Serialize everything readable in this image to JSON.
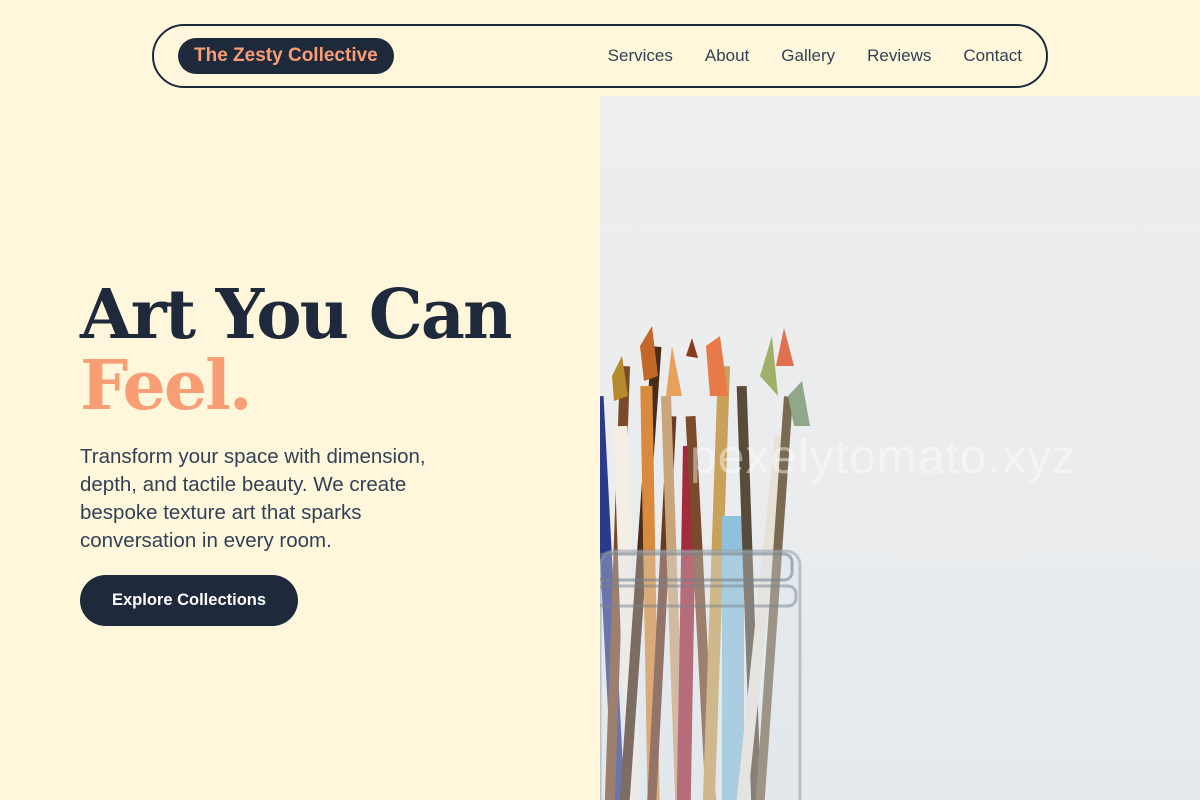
{
  "nav": {
    "brand": "The Zesty Collective",
    "links": [
      "Services",
      "About",
      "Gallery",
      "Reviews",
      "Contact"
    ]
  },
  "hero": {
    "headline_line1": "Art You Can",
    "headline_line2": "Feel.",
    "subtext": "Transform your space with dimension, depth, and tactile beauty. We create bespoke texture art that sparks conversation in every room.",
    "cta_label": "Explore Collections"
  },
  "image": {
    "watermark": "pexelytomato.xyz"
  },
  "colors": {
    "background": "#fff7db",
    "navy": "#1e293b",
    "accent": "#f79e74"
  }
}
